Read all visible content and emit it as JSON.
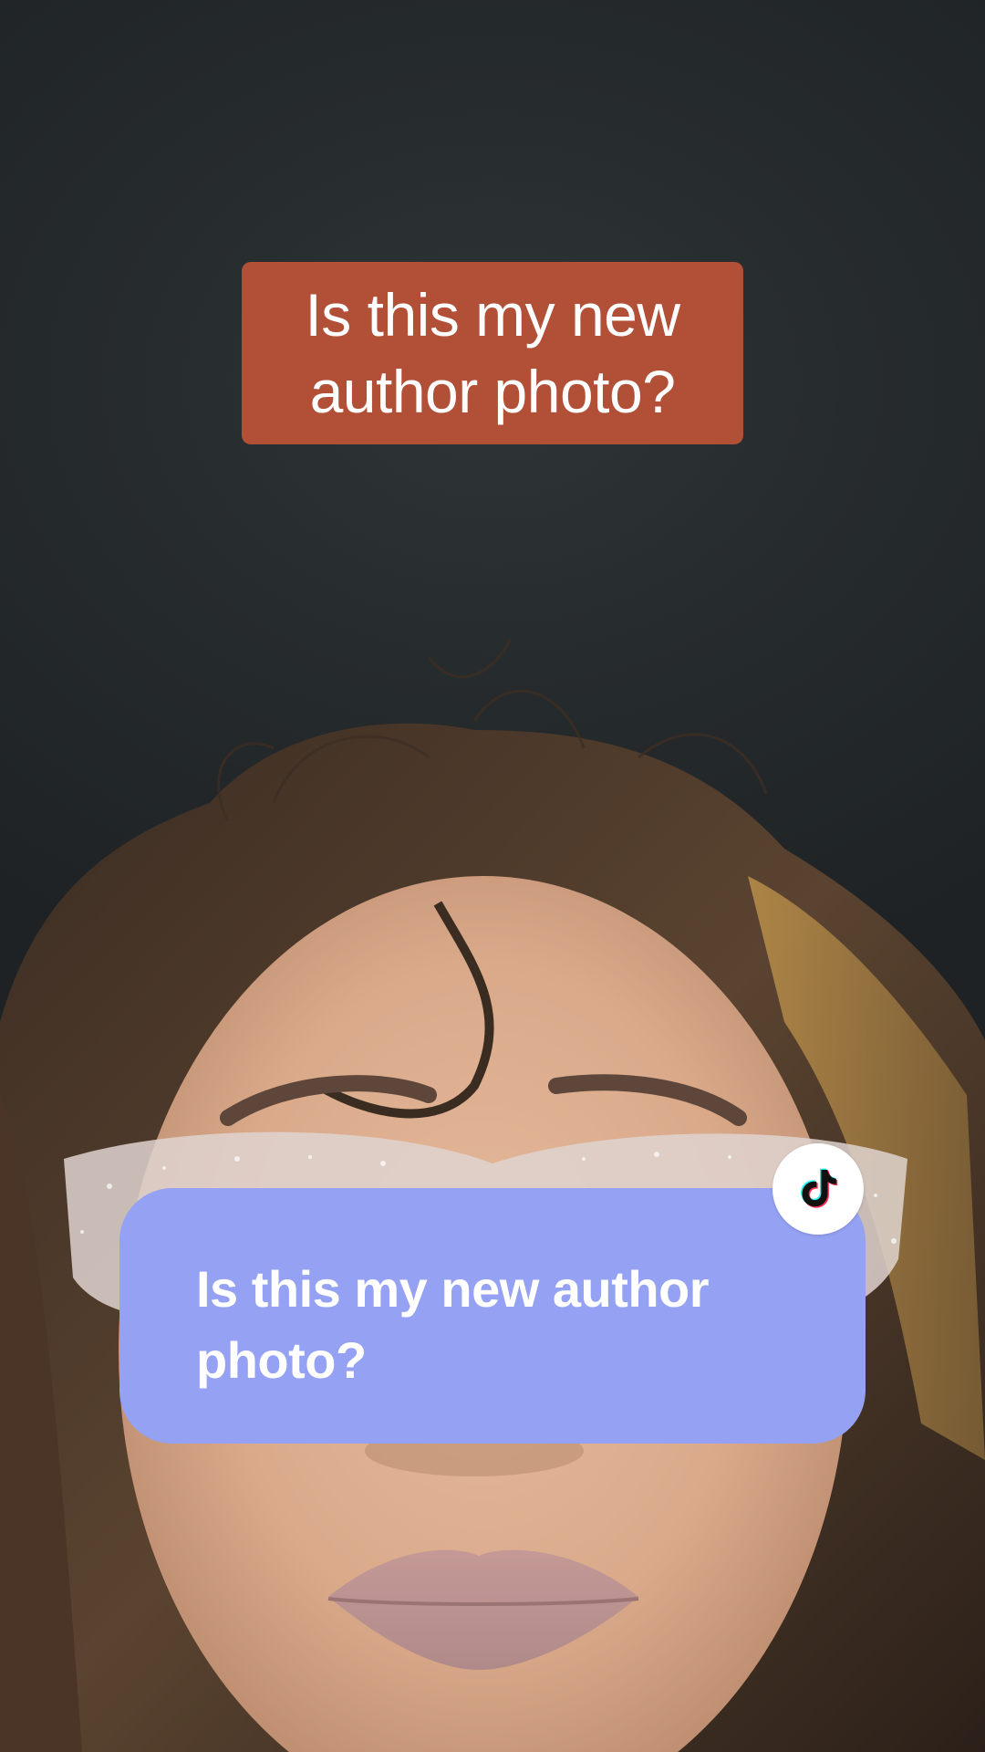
{
  "video": {
    "caption_sticker": "Is this my new author photo?",
    "reply_bubble": {
      "text": "Is this my new author photo?",
      "badge_icon": "tiktok-logo-icon"
    }
  },
  "colors": {
    "caption_background": "#b14f37",
    "reply_background": "#95a1f3",
    "text": "#ffffff"
  }
}
